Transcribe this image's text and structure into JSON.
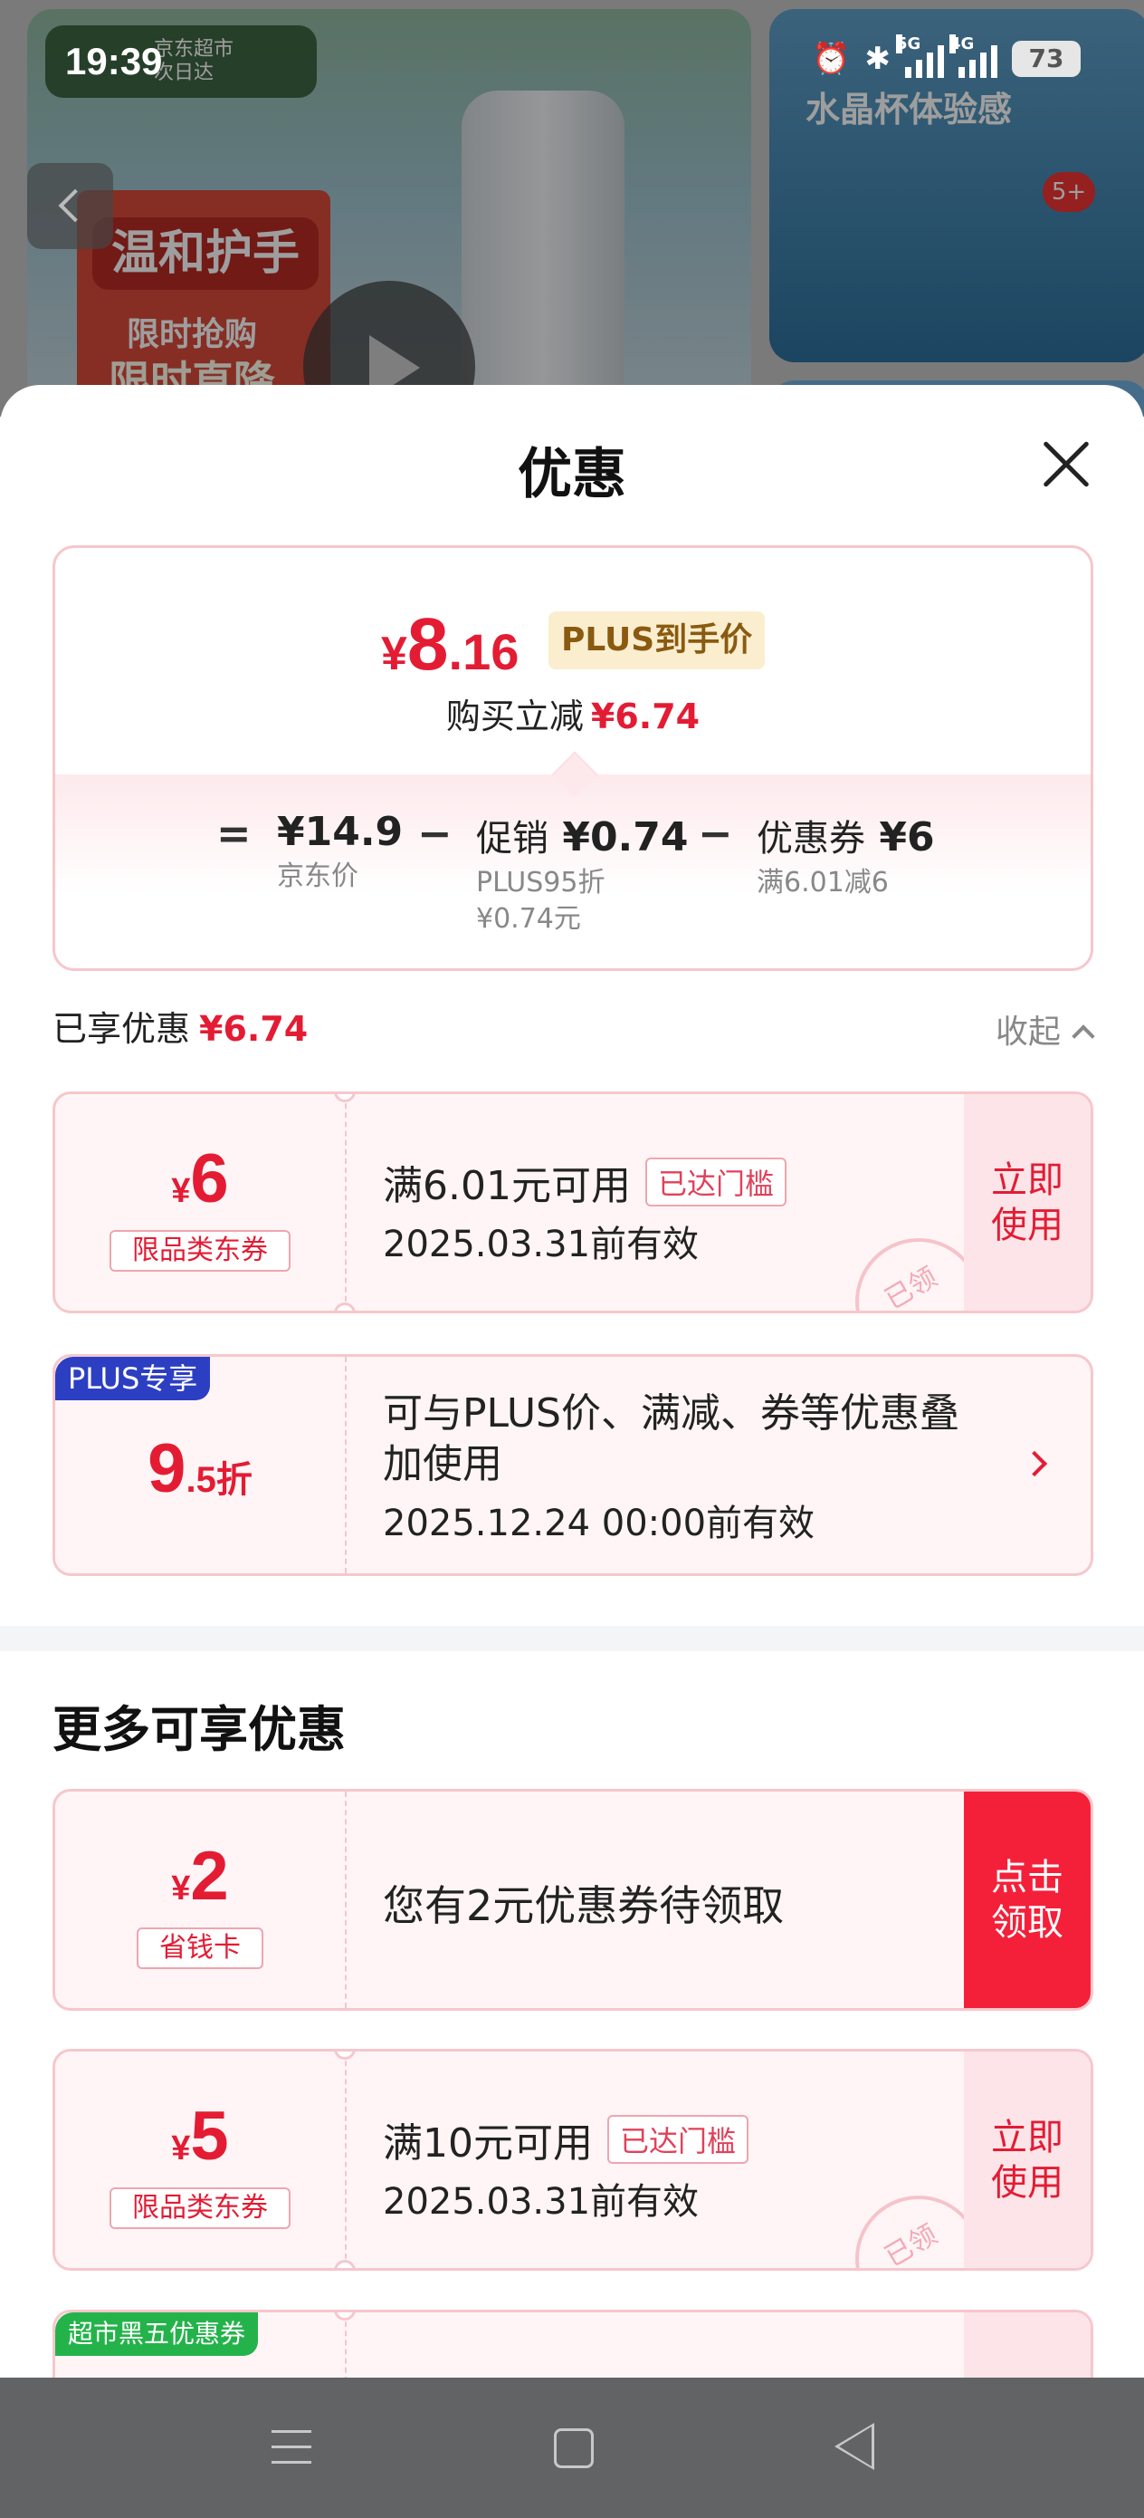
{
  "status_bar": {
    "time": "19:39",
    "network_1": "5G",
    "network_2": "4G",
    "battery": "73",
    "icons": [
      "alarm-icon",
      "bluetooth-icon",
      "signal-5g-icon",
      "signal-4g-icon",
      "battery-icon"
    ]
  },
  "background": {
    "store_tag": "京东超市\n次日达",
    "promo_title": "温和护手",
    "promo_sub1": "限时抢购",
    "promo_sub2": "限时直降",
    "right_title": "水晶杯体验感",
    "right_count": "5+"
  },
  "sheet": {
    "title": "优惠",
    "close_icon": "close-icon"
  },
  "summary": {
    "currency": "¥",
    "final_int": "8",
    "final_dec": ".16",
    "plus_label": "PLUS到手价",
    "reduce_label": "购买立减",
    "reduce_amount": "¥6.74",
    "equals": "=",
    "minus": "−",
    "jd_price": "¥14.9",
    "jd_price_label": "京东价",
    "promo_prefix": "促销",
    "promo_amount": "¥0.74",
    "promo_note1": "PLUS95折",
    "promo_note2": "¥0.74元",
    "coupon_prefix": "优惠券",
    "coupon_amount": "¥6",
    "coupon_note": "满6.01减6"
  },
  "enjoyed": {
    "label": "已享优惠",
    "amount": "¥6.74",
    "collapse_label": "收起"
  },
  "coupons_enjoyed": [
    {
      "currency": "¥",
      "amount": "6",
      "type": "限品类东券",
      "condition": "满6.01元可用",
      "reached": "已达门槛",
      "date": "2025.03.31前有效",
      "action": "立即\n使用",
      "stamp": "已领"
    }
  ],
  "plus_discount": {
    "tag": "PLUS专享",
    "rate_int": "9",
    "rate_dec": ".5折",
    "desc": "可与PLUS价、满减、券等优惠叠加使用",
    "date": "2025.12.24 00:00前有效"
  },
  "more": {
    "title": "更多可享优惠",
    "coupons": [
      {
        "currency": "¥",
        "amount": "2",
        "type": "省钱卡",
        "text": "您有2元优惠券待领取",
        "action": "点击\n领取"
      },
      {
        "currency": "¥",
        "amount": "5",
        "type": "限品类东券",
        "condition": "满10元可用",
        "reached": "已达门槛",
        "date": "2025.03.31前有效",
        "action": "立即\n使用",
        "stamp": "已领"
      },
      {
        "tag": "超市黑五优惠券"
      }
    ]
  },
  "nav": {
    "icons": [
      "menu-icon",
      "home-icon",
      "back-icon"
    ]
  }
}
